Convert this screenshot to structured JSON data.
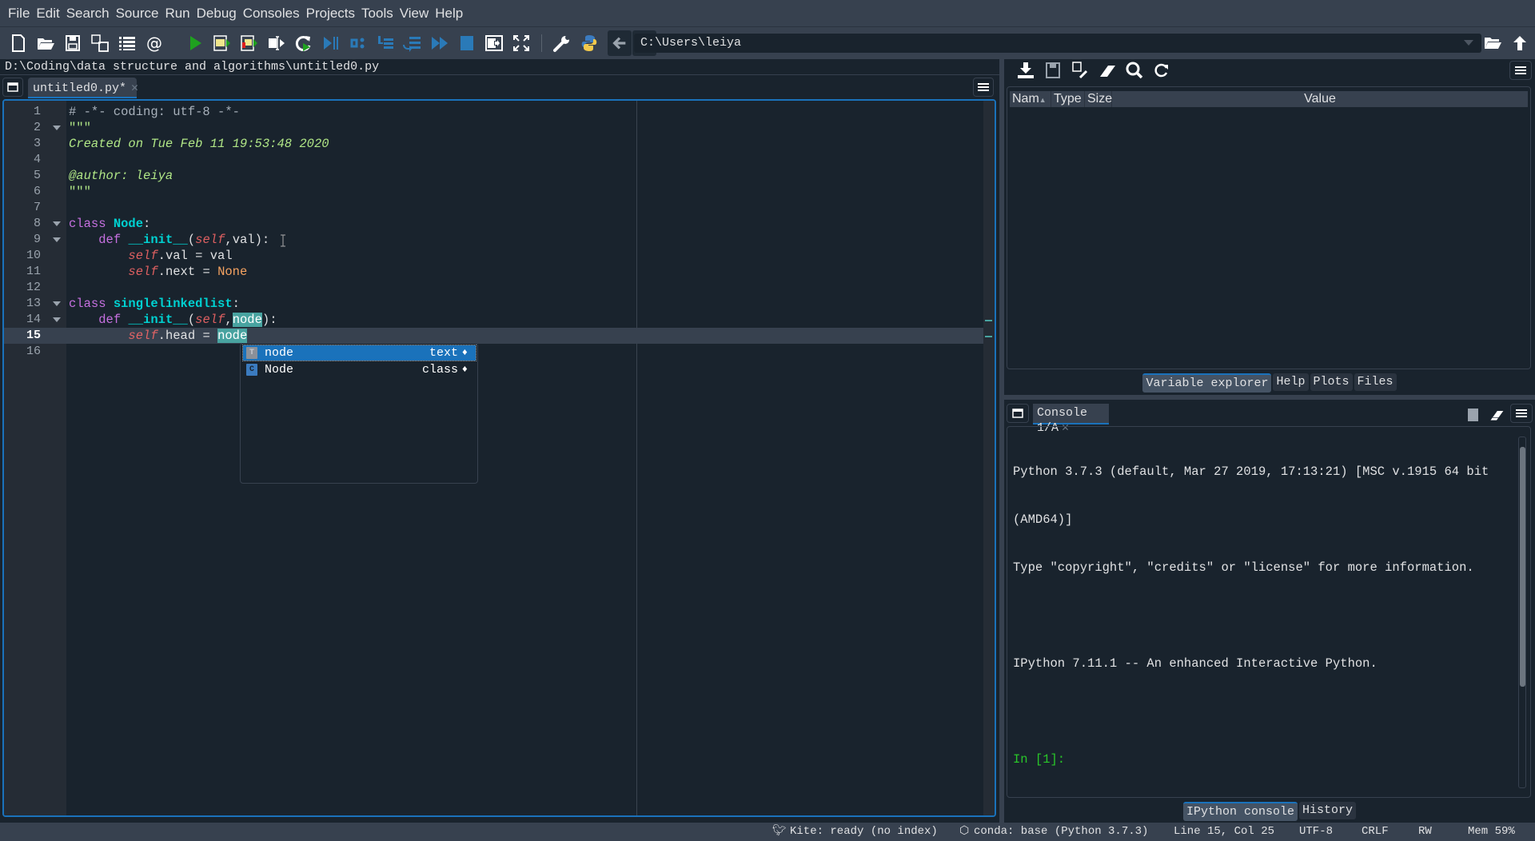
{
  "menu": [
    "File",
    "Edit",
    "Search",
    "Source",
    "Run",
    "Debug",
    "Consoles",
    "Projects",
    "Tools",
    "View",
    "Help"
  ],
  "toolbar": {
    "icons": [
      "new-file-icon",
      "open-file-icon",
      "save-icon",
      "save-all-icon",
      "outline-icon",
      "at-icon",
      "run-icon",
      "run-cell-icon",
      "run-cell-advance-icon",
      "run-selection-icon",
      "rerun-icon",
      "debug-icon",
      "step-icon",
      "step-into-icon",
      "step-return-icon",
      "continue-icon",
      "stop-icon",
      "maximize-pane-icon",
      "fullscreen-icon",
      "preferences-icon",
      "python-path-icon",
      "back-icon",
      "forward-icon"
    ],
    "working_dir": "C:\\Users\\leiya"
  },
  "editor": {
    "file_path": "D:\\Coding\\data structure and algorithms\\untitled0.py",
    "tab_label": "untitled0.py*",
    "current_line": 15,
    "lines": [
      {
        "n": "1",
        "fold": false
      },
      {
        "n": "2",
        "fold": true
      },
      {
        "n": "3",
        "fold": false
      },
      {
        "n": "4",
        "fold": false
      },
      {
        "n": "5",
        "fold": false
      },
      {
        "n": "6",
        "fold": false
      },
      {
        "n": "7",
        "fold": false
      },
      {
        "n": "8",
        "fold": true
      },
      {
        "n": "9",
        "fold": true
      },
      {
        "n": "10",
        "fold": false
      },
      {
        "n": "11",
        "fold": false
      },
      {
        "n": "12",
        "fold": false
      },
      {
        "n": "13",
        "fold": true
      },
      {
        "n": "14",
        "fold": true
      },
      {
        "n": "15",
        "fold": false
      },
      {
        "n": "16",
        "fold": false
      }
    ],
    "code": {
      "l1": "# -*- coding: utf-8 -*-",
      "l2": "\"\"\"",
      "l3": "Created on Tue Feb 11 19:53:48 2020",
      "l5": "@author: leiya",
      "l6": "\"\"\"",
      "kw_class": "class",
      "kw_def": "def",
      "self": "self",
      "node_class": "Node",
      "colon": ":",
      "init": "__init__",
      "init_args_1": ",val):",
      "l10_rest": ".val = val",
      "l11_rest": ".next = ",
      "none": "None",
      "sll_class": "singlelinkedlist",
      "comma": ",",
      "node_param": "node",
      "close": "):",
      "l15_rest": ".head = ",
      "open_paren": "("
    }
  },
  "completion": {
    "items": [
      {
        "icon": "T",
        "name": "node",
        "type": "text",
        "selected": true
      },
      {
        "icon": "C",
        "name": "Node",
        "type": "class",
        "selected": false
      }
    ]
  },
  "variable_explorer": {
    "columns": [
      "Nam",
      "Type",
      "Size",
      "Value"
    ]
  },
  "pane_tabs": [
    "Variable explorer",
    "Help",
    "Plots",
    "Files"
  ],
  "console": {
    "tab_label": "Console 1/A",
    "banner": [
      "Python 3.7.3 (default, Mar 27 2019, 17:13:21) [MSC v.1915 64 bit",
      "(AMD64)]",
      "Type \"copyright\", \"credits\" or \"license\" for more information.",
      "",
      "IPython 7.11.1 -- An enhanced Interactive Python.",
      ""
    ],
    "prompt": "In [1]:"
  },
  "bottom_tabs": [
    "IPython console",
    "History"
  ],
  "status": {
    "kite": "Kite: ready (no index)",
    "conda": "conda: base (Python 3.7.3)",
    "position": "Line 15, Col 25",
    "encoding": "UTF-8",
    "eol": "CRLF",
    "rw": "RW",
    "mem": "Mem 59%"
  },
  "colors": {
    "accent": "#1a72bb",
    "background": "#19232d",
    "panel": "#37414f",
    "match_highlight": "#48a3a0",
    "prompt": "#29c629"
  }
}
